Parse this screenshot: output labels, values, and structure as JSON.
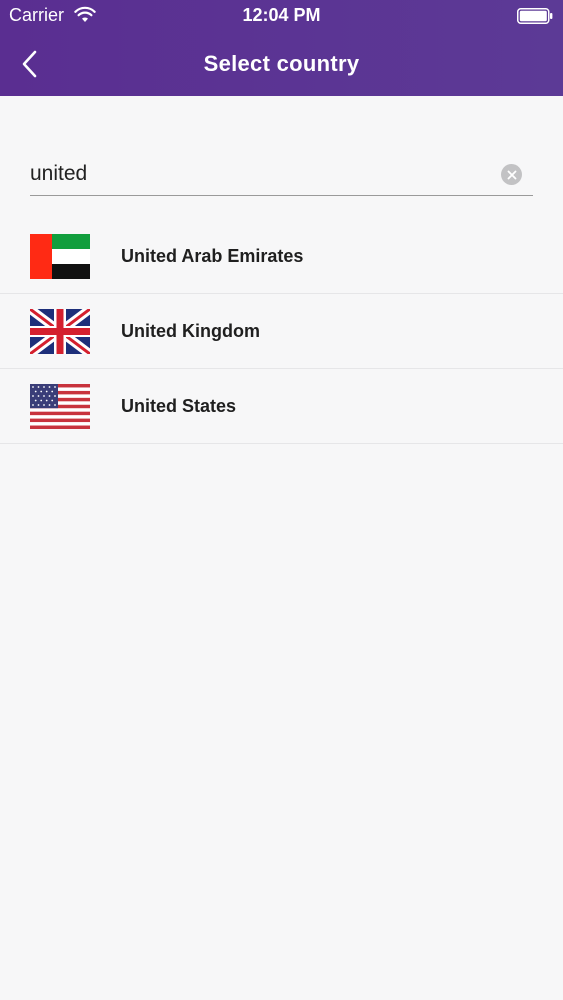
{
  "status_bar": {
    "carrier": "Carrier",
    "time": "12:04 PM"
  },
  "nav": {
    "title": "Select country",
    "back_icon": "chevron-left-icon"
  },
  "search": {
    "value": "united",
    "clear_icon": "clear-circle-icon"
  },
  "countries": [
    {
      "name": "United Arab Emirates",
      "flag": "uae-flag"
    },
    {
      "name": "United Kingdom",
      "flag": "uk-flag"
    },
    {
      "name": "United States",
      "flag": "us-flag"
    }
  ],
  "colors": {
    "header": "#5a2e91",
    "background": "#f7f7f8",
    "caret": "#3b6fd6"
  }
}
